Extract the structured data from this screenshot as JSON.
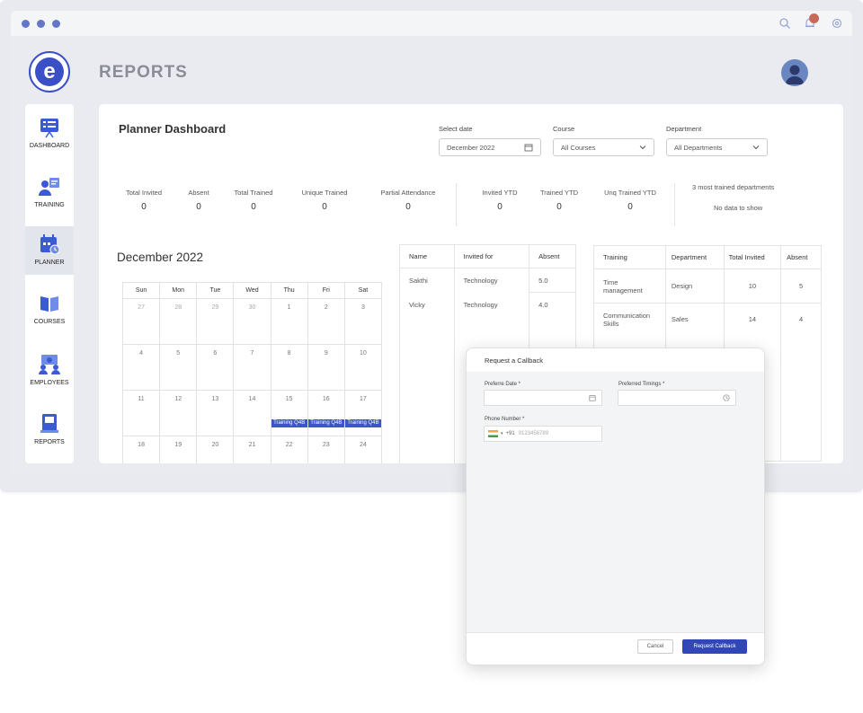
{
  "app": {
    "page_title": "REPORTS",
    "logo_letter": "e"
  },
  "sidebar": {
    "items": [
      {
        "label": "DASHBOARD",
        "icon": "dashboard-icon"
      },
      {
        "label": "TRAINING",
        "icon": "training-icon"
      },
      {
        "label": "PLANNER",
        "icon": "planner-icon",
        "active": true
      },
      {
        "label": "COURSES",
        "icon": "courses-icon"
      },
      {
        "label": "EMPLOYEES",
        "icon": "employees-icon"
      },
      {
        "label": "REPORTS",
        "icon": "reports-icon"
      }
    ]
  },
  "planner": {
    "title": "Planner Dashboard",
    "select_date": {
      "label": "Select date",
      "value": "December 2022"
    },
    "course": {
      "label": "Course",
      "value": "All Courses"
    },
    "department": {
      "label": "Department",
      "value": "All Departments"
    }
  },
  "stats": [
    {
      "label": "Total Invited",
      "value": "0"
    },
    {
      "label": "Absent",
      "value": "0"
    },
    {
      "label": "Total Trained",
      "value": "0"
    },
    {
      "label": "Unique Trained",
      "value": "0"
    },
    {
      "label": "Partial Attendance",
      "value": "0"
    },
    {
      "label": "Invited YTD",
      "value": "0"
    },
    {
      "label": "Trained YTD",
      "value": "0"
    },
    {
      "label": "Unq Trained YTD",
      "value": "0"
    }
  ],
  "top_departments": {
    "label": "3 most trained departments",
    "empty": "No data to show"
  },
  "calendar": {
    "title": "December 2022",
    "weekdays": [
      "Sun",
      "Mon",
      "Tue",
      "Wed",
      "Thu",
      "Fri",
      "Sat"
    ],
    "weeks": [
      [
        "27",
        "28",
        "29",
        "30",
        "1",
        "2",
        "3"
      ],
      [
        "4",
        "5",
        "6",
        "7",
        "8",
        "9",
        "10"
      ],
      [
        "11",
        "12",
        "13",
        "14",
        "15",
        "16",
        "17"
      ],
      [
        "18",
        "19",
        "20",
        "21",
        "22",
        "23",
        "24"
      ]
    ],
    "event_label": "Training Q4B"
  },
  "absent_table": {
    "headers": [
      "Name",
      "Invited for",
      "Absent"
    ],
    "rows": [
      [
        "Sakthi",
        "Technology",
        "5.0"
      ],
      [
        "Vicky",
        "Technology",
        "4.0"
      ]
    ]
  },
  "training_table": {
    "headers": [
      "Training",
      "Department",
      "Total Invited",
      "Absent"
    ],
    "rows": [
      [
        "Time management",
        "Design",
        "10",
        "5"
      ],
      [
        "Communication Skills",
        "Sales",
        "14",
        "4"
      ]
    ]
  },
  "callback_dialog": {
    "title": "Request a Callback",
    "preferred_date_label": "Preferre Date *",
    "preferred_timings_label": "Preferred Timings *",
    "phone_label": "Phone Number *",
    "phone_placeholder": "9123456789",
    "country_code": "+91",
    "cancel_label": "Cancel",
    "submit_label": "Request Callback"
  },
  "colors": {
    "accent": "#3147b8",
    "event": "#3c56c8",
    "notification": "#c86a5a"
  }
}
